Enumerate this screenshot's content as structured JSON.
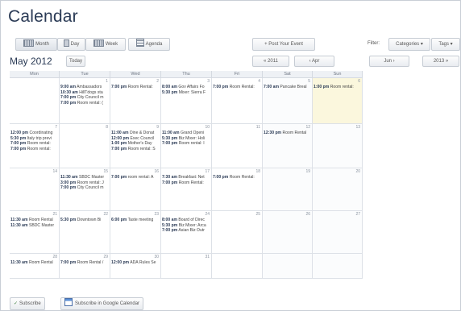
{
  "title": "Calendar",
  "views": [
    {
      "label": "Month",
      "icon": "month-view-icon",
      "selected": true
    },
    {
      "label": "Day",
      "icon": "day-view-icon",
      "selected": false
    },
    {
      "label": "Week",
      "icon": "week-view-icon",
      "selected": false
    },
    {
      "label": "Agenda",
      "icon": "agenda-view-icon",
      "selected": false
    }
  ],
  "post_event_label": "+ Post Your Event",
  "filter": {
    "label": "Filter:",
    "categories": "Categories ▾",
    "tags": "Tags ▾"
  },
  "current_month": "May 2012",
  "today_label": "Today",
  "nav": {
    "prev_year": "« 2011",
    "prev_month": "‹ Apr",
    "next_month": "Jun ›",
    "next_year": "2013 »"
  },
  "weekdays": [
    "Mon",
    "Tue",
    "Wed",
    "Thu",
    "Fri",
    "Sat",
    "Sun"
  ],
  "weeks": [
    [
      {
        "day": "",
        "events": []
      },
      {
        "day": "1",
        "events": [
          {
            "time": "9:00 am",
            "text": "Ambassadors"
          },
          {
            "time": "10:30 am",
            "text": "HillTdogs sta"
          },
          {
            "time": "7:00 pm",
            "text": "City Council m"
          },
          {
            "time": "7:00 pm",
            "text": "Room rental: ("
          }
        ]
      },
      {
        "day": "2",
        "events": [
          {
            "time": "7:00 pm",
            "text": "Room Rental:"
          }
        ]
      },
      {
        "day": "3",
        "events": [
          {
            "time": "8:00 am",
            "text": "Gov Affairs Fo"
          },
          {
            "time": "5:30 pm",
            "text": "Mixer: Sierra F"
          }
        ]
      },
      {
        "day": "4",
        "events": [
          {
            "time": "7:00 pm",
            "text": "Room Rental:"
          }
        ]
      },
      {
        "day": "5",
        "events": [
          {
            "time": "7:00 am",
            "text": "Pancake Breal"
          }
        ]
      },
      {
        "day": "6",
        "today": true,
        "events": [
          {
            "time": "1:00 pm",
            "text": "Room rental:"
          }
        ]
      }
    ],
    [
      {
        "day": "7",
        "events": [
          {
            "time": "12:00 pm",
            "text": "Coordinating"
          },
          {
            "time": "5:30 pm",
            "text": "Italy trip previ"
          },
          {
            "time": "7:00 pm",
            "text": "Room rental:"
          },
          {
            "time": "7:00 pm",
            "text": "Room rental:"
          }
        ]
      },
      {
        "day": "8",
        "events": []
      },
      {
        "day": "9",
        "events": [
          {
            "time": "11:00 am",
            "text": "Dine & Donat"
          },
          {
            "time": "12:00 pm",
            "text": "Exec Council"
          },
          {
            "time": "1:00 pm",
            "text": "Mother's Day"
          },
          {
            "time": "7:00 pm",
            "text": "Room rental: S"
          }
        ]
      },
      {
        "day": "10",
        "events": [
          {
            "time": "11:00 am",
            "text": "Grand Openi"
          },
          {
            "time": "5:30 pm",
            "text": "Biz Mixer: Holi"
          },
          {
            "time": "7:00 pm",
            "text": "Room rental: I"
          }
        ]
      },
      {
        "day": "11",
        "events": []
      },
      {
        "day": "12",
        "events": [
          {
            "time": "12:30 pm",
            "text": "Room Rental"
          }
        ]
      },
      {
        "day": "13",
        "events": []
      }
    ],
    [
      {
        "day": "14",
        "events": []
      },
      {
        "day": "15",
        "events": [
          {
            "time": "11:30 am",
            "text": "SBDC Master"
          },
          {
            "time": "3:00 pm",
            "text": "Room rental: J"
          },
          {
            "time": "7:00 pm",
            "text": "City Council m"
          }
        ]
      },
      {
        "day": "16",
        "events": [
          {
            "time": "7:00 pm",
            "text": "room rental: A"
          }
        ]
      },
      {
        "day": "17",
        "events": [
          {
            "time": "7:30 am",
            "text": "Breakfast: Net"
          },
          {
            "time": "7:00 pm",
            "text": "Room Rental:"
          }
        ]
      },
      {
        "day": "18",
        "events": [
          {
            "time": "7:00 pm",
            "text": "Room Rental:"
          }
        ]
      },
      {
        "day": "19",
        "events": []
      },
      {
        "day": "20",
        "events": []
      }
    ],
    [
      {
        "day": "21",
        "events": [
          {
            "time": "11:30 am",
            "text": "Room Rental"
          },
          {
            "time": "11:30 am",
            "text": "SBDC Master"
          }
        ]
      },
      {
        "day": "22",
        "events": [
          {
            "time": "5:30 pm",
            "text": "Downtown Bi"
          }
        ]
      },
      {
        "day": "23",
        "events": [
          {
            "time": "6:00 pm",
            "text": "Taste meeting"
          }
        ]
      },
      {
        "day": "24",
        "events": [
          {
            "time": "8:00 am",
            "text": "Board of Direc"
          },
          {
            "time": "5:30 pm",
            "text": "Biz Mixer: Arca"
          },
          {
            "time": "7:00 pm",
            "text": "Asian Biz Outr"
          }
        ]
      },
      {
        "day": "25",
        "events": []
      },
      {
        "day": "26",
        "events": []
      },
      {
        "day": "27",
        "events": []
      }
    ],
    [
      {
        "day": "28",
        "events": [
          {
            "time": "11:30 am",
            "text": "Room Rental"
          }
        ]
      },
      {
        "day": "29",
        "events": [
          {
            "time": "7:00 pm",
            "text": "Room Rental /"
          }
        ]
      },
      {
        "day": "30",
        "events": [
          {
            "time": "12:00 pm",
            "text": "ADA Rules Se"
          }
        ]
      },
      {
        "day": "31",
        "events": []
      },
      {
        "day": "",
        "events": []
      },
      {
        "day": "",
        "events": []
      },
      {
        "day": "",
        "events": []
      }
    ]
  ],
  "footer": {
    "subscribe": "Subscribe",
    "google": "Subscribe in Google Calendar"
  }
}
